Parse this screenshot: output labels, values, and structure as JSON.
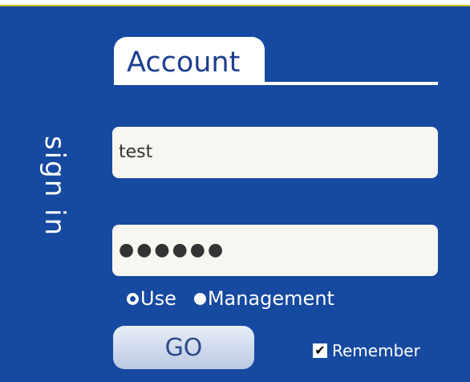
{
  "side_label": "sign in",
  "tab": {
    "label": "Account"
  },
  "username": {
    "value": "test"
  },
  "password": {
    "masked": "●●●●●●"
  },
  "mode": {
    "options": [
      {
        "label": "Use",
        "selected": true
      },
      {
        "label": "Management",
        "selected": false
      }
    ]
  },
  "go_button": {
    "label": "GO"
  },
  "remember": {
    "label": "Remember",
    "checked": true,
    "check_glyph": "✔"
  },
  "colors": {
    "panel": "#1649a0",
    "field": "#f8f6f1",
    "tab_text": "#1c3f8f",
    "button_top": "#e8eef8",
    "button_bottom": "#b9c9e3"
  }
}
